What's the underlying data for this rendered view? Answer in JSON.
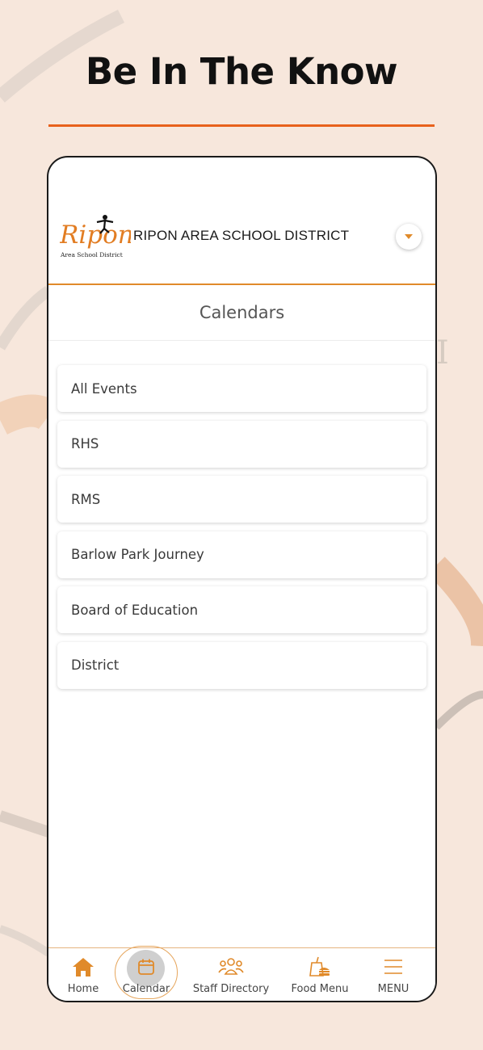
{
  "promo": {
    "headline": "Be In The Know"
  },
  "header": {
    "logo_text": "Ripon",
    "logo_subtext": "Area School District",
    "district_name": "RIPON AREA SCHOOL DISTRICT",
    "dropdown_icon": "caret-down-icon"
  },
  "page": {
    "title": "Calendars"
  },
  "calendars": [
    {
      "label": "All Events"
    },
    {
      "label": "RHS"
    },
    {
      "label": "RMS"
    },
    {
      "label": "Barlow Park Journey"
    },
    {
      "label": "Board of Education"
    },
    {
      "label": "District"
    }
  ],
  "tabbar": {
    "active": "Calendar",
    "tabs": [
      {
        "label": "Home",
        "icon": "home-icon"
      },
      {
        "label": "Calendar",
        "icon": "calendar-icon"
      },
      {
        "label": "Staff Directory",
        "icon": "staff-directory-icon"
      },
      {
        "label": "Food Menu",
        "icon": "food-menu-icon"
      },
      {
        "label": "MENU",
        "icon": "menu-icon"
      }
    ]
  },
  "colors": {
    "accent": "#e8621c",
    "icon_orange": "#e08a2a",
    "background": "#f7e7dc"
  }
}
